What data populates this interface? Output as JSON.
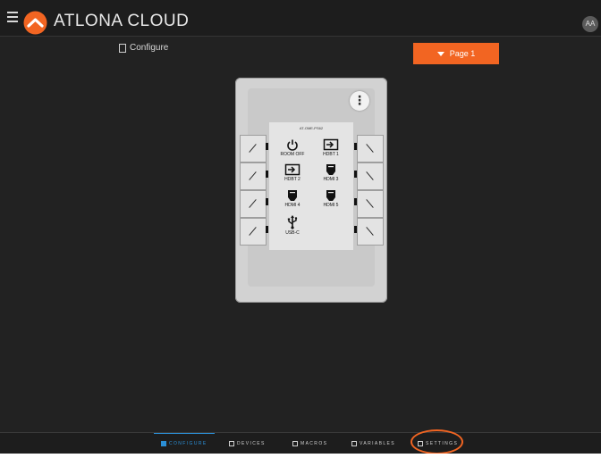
{
  "header": {
    "menu_icon": "hamburger-icon",
    "brand": "ATLONA CLOUD",
    "logo_icon": "atlona-chevron-logo-icon",
    "avatar_initials": "AA"
  },
  "toolbar": {
    "configure_label": "Configure",
    "page_selected": "Page 1"
  },
  "keypad": {
    "model": "AT-OME-PS62",
    "buttons": [
      {
        "label": "ROOM OFF",
        "icon": "power-icon"
      },
      {
        "label": "HDBT 1",
        "icon": "input-icon"
      },
      {
        "label": "HDBT 2",
        "icon": "input-icon"
      },
      {
        "label": "HDMI 3",
        "icon": "hdmi-icon"
      },
      {
        "label": "HDMI 4",
        "icon": "hdmi-icon"
      },
      {
        "label": "HDMI 5",
        "icon": "hdmi-icon"
      },
      {
        "label": "USB-C",
        "icon": "usb-icon"
      }
    ]
  },
  "bottom_nav": {
    "items": [
      {
        "label": "CONFIGURE",
        "active": true
      },
      {
        "label": "DEVICES",
        "active": false
      },
      {
        "label": "MACROS",
        "active": false
      },
      {
        "label": "VARIABLES",
        "active": false
      },
      {
        "label": "SETTINGS",
        "active": false
      }
    ]
  },
  "colors": {
    "accent": "#f26522",
    "active_nav": "#2b8fd6",
    "background": "#222222"
  }
}
